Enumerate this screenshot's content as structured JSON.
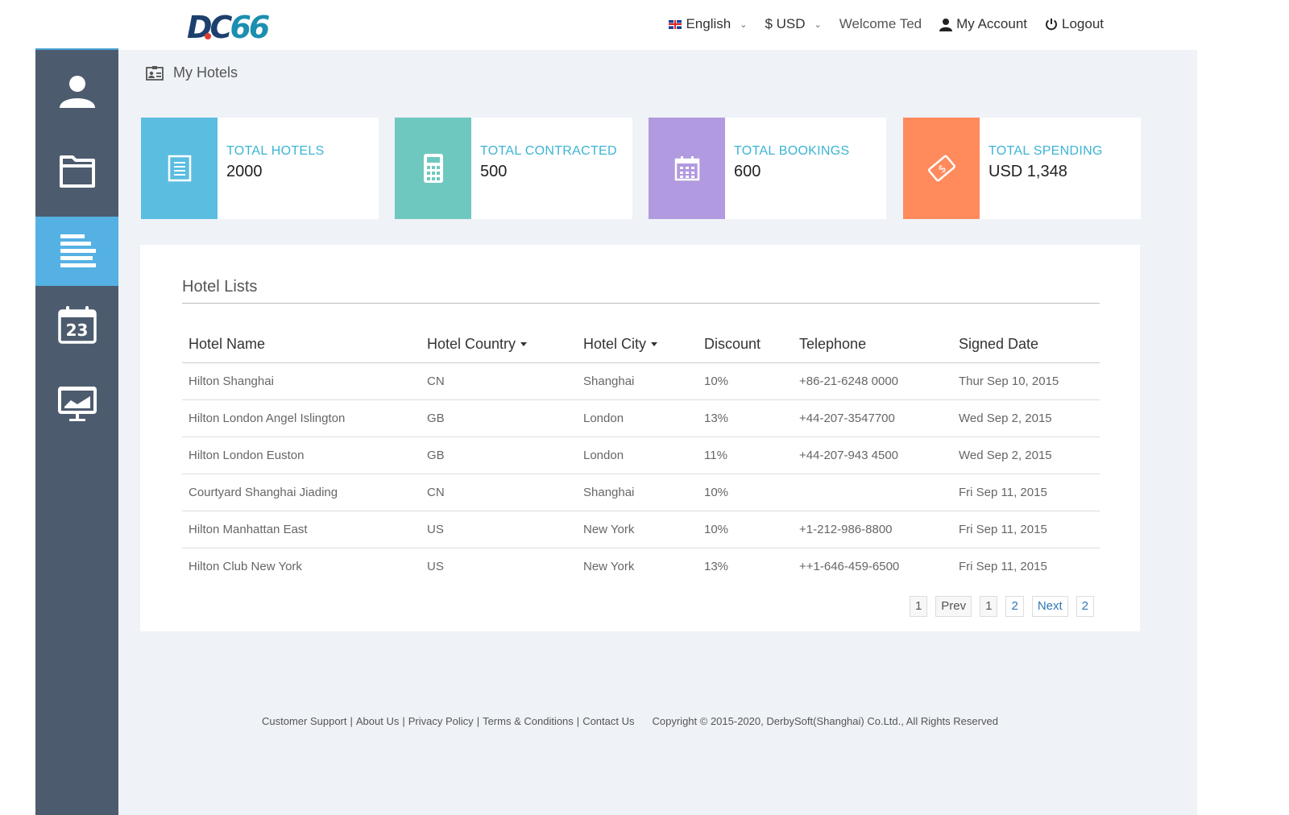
{
  "logo": {
    "part1": "DC",
    "part2": "66"
  },
  "header": {
    "language": "English",
    "currency": "$ USD",
    "welcome": "Welcome Ted",
    "account": "My Account",
    "logout": "Logout"
  },
  "sidebar": {
    "items": [
      {
        "icon": "user-icon"
      },
      {
        "icon": "folder-icon"
      },
      {
        "icon": "list-icon",
        "active": true
      },
      {
        "icon": "calendar-icon",
        "text": "23"
      },
      {
        "icon": "presentation-icon"
      }
    ]
  },
  "page": {
    "title": "My Hotels"
  },
  "stats": [
    {
      "label": "TOTAL HOTELS",
      "value": "2000",
      "color": "#5bbde0",
      "icon": "document-icon"
    },
    {
      "label": "TOTAL CONTRACTED",
      "value": "500",
      "color": "#6fc8c0",
      "icon": "calculator-icon"
    },
    {
      "label": "TOTAL BOOKINGS",
      "value": "600",
      "color": "#b19adf",
      "icon": "calendar-grid-icon"
    },
    {
      "label": "TOTAL SPENDING",
      "value": "USD 1,348",
      "color": "#ff8a5c",
      "icon": "money-icon"
    }
  ],
  "hotel_list": {
    "title": "Hotel Lists",
    "columns": [
      "Hotel Name",
      "Hotel Country",
      "Hotel City",
      "Discount",
      "Telephone",
      "Signed Date"
    ],
    "rows": [
      [
        "Hilton Shanghai",
        "CN",
        "Shanghai",
        "10%",
        "+86-21-6248 0000",
        "Thur Sep 10, 2015"
      ],
      [
        "Hilton London Angel Islington",
        "GB",
        "London",
        "13%",
        "+44-207-3547700",
        "Wed Sep 2, 2015"
      ],
      [
        "Hilton London Euston",
        "GB",
        "London",
        "11%",
        "+44-207-943 4500",
        "Wed Sep 2, 2015"
      ],
      [
        "Courtyard Shanghai Jiading",
        "CN",
        "Shanghai",
        "10%",
        "",
        "Fri Sep 11, 2015"
      ],
      [
        "Hilton Manhattan East",
        "US",
        "New York",
        "10%",
        "+1-212-986-8800",
        "Fri Sep 11, 2015"
      ],
      [
        "Hilton Club New York",
        "US",
        "New York",
        "13%",
        "++1-646-459-6500",
        "Fri Sep 11, 2015"
      ]
    ]
  },
  "pagination": [
    "1",
    "Prev",
    "1",
    "2",
    "Next",
    "2"
  ],
  "footer": {
    "links": [
      "Customer Support",
      "About Us",
      "Privacy Policy",
      "Terms & Conditions",
      "Contact Us"
    ],
    "separator": "|",
    "copyright": "Copyright © 2015-2020, DerbySoft(Shanghai) Co.Ltd., All Rights Reserved"
  },
  "colors": {
    "sidebar": "#4d5b6e",
    "sidebar_active": "#55b1e3",
    "background": "#eff2f7",
    "accent_text": "#3cb4d5",
    "link": "#2f76b7"
  }
}
